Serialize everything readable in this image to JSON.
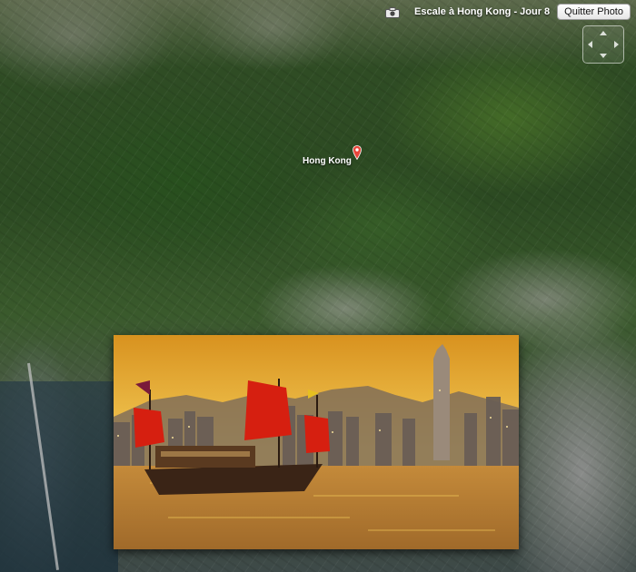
{
  "app": {
    "title": "Escale à Hong Kong - Jour 8",
    "quit_label": "Quitter Photo"
  },
  "map": {
    "location_label": "Hong Kong"
  },
  "icons": {
    "camera": "camera-icon",
    "pin": "map-pin-icon",
    "navigation": "navigation-arrows-icon"
  },
  "colors": {
    "pin": "#e8463b",
    "sail": "#d61f10",
    "sky": "#f3cc5a"
  }
}
